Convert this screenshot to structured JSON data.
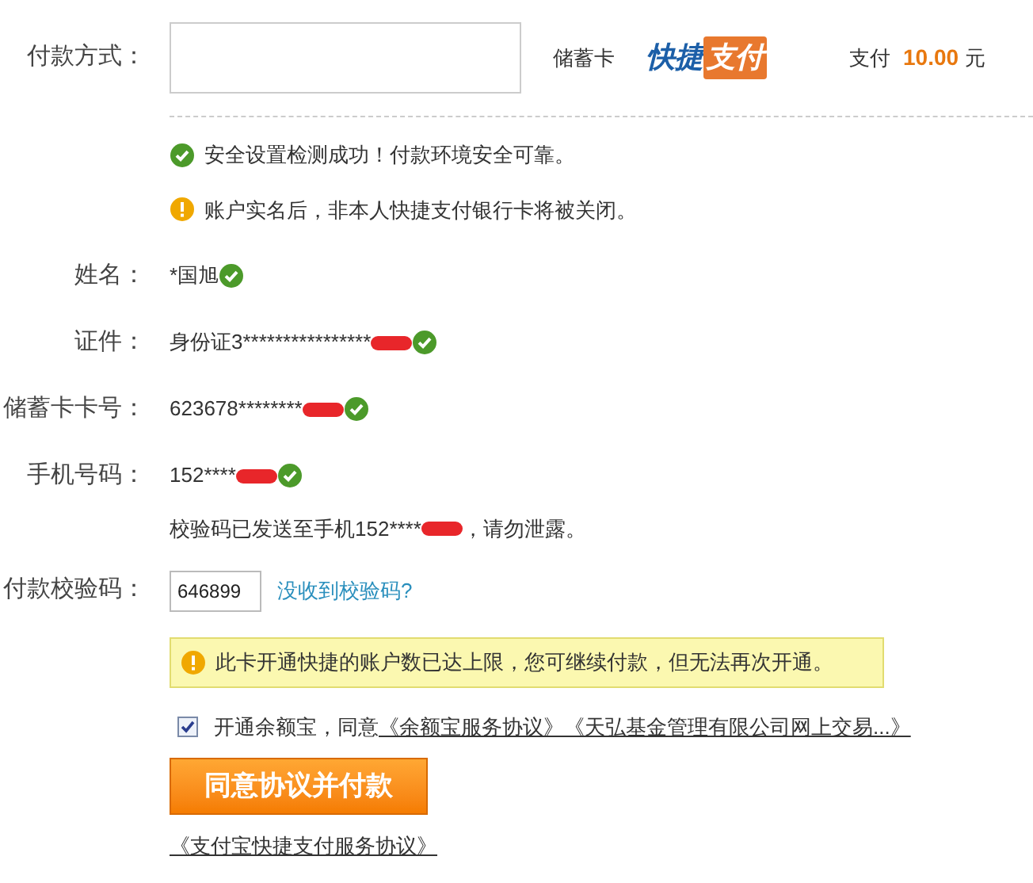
{
  "payment_method": {
    "label": "付款方式：",
    "card_type": "储蓄卡",
    "logo": {
      "part_1": "快捷",
      "part_2": "支付"
    },
    "pay_label": "支付",
    "amount": "10.00",
    "currency": "元"
  },
  "notices": [
    {
      "kind": "success",
      "text": "安全设置检测成功！付款环境安全可靠。"
    },
    {
      "kind": "warning",
      "text": "账户实名后，非本人快捷支付银行卡将被关闭。"
    }
  ],
  "fields": [
    {
      "label": "姓名：",
      "value": "*国旭",
      "redacted": false,
      "verified": true
    },
    {
      "label": "证件：",
      "value": "身份证3****************",
      "redacted": true,
      "verified": true
    },
    {
      "label": "储蓄卡卡号：",
      "value": "623678********",
      "redacted": true,
      "verified": true
    },
    {
      "label": "手机号码：",
      "value": "152****",
      "redacted": true,
      "verified": true
    }
  ],
  "sms_notice": {
    "before": "校验码已发送至手机152****",
    "after": "，请勿泄露。"
  },
  "verification": {
    "label": "付款校验码：",
    "value": "646899",
    "resend_link": "没收到校验码?"
  },
  "limit_warning": "此卡开通快捷的账户数已达上限，您可继续付款，但无法再次开通。",
  "agreement": {
    "checked": true,
    "text": "开通余额宝，同意",
    "links": [
      "《余额宝服务协议》",
      "《天弘基金管理有限公司网上交易...》"
    ]
  },
  "submit_button": "同意协议并付款",
  "footer_link": "《支付宝快捷支付服务协议》"
}
